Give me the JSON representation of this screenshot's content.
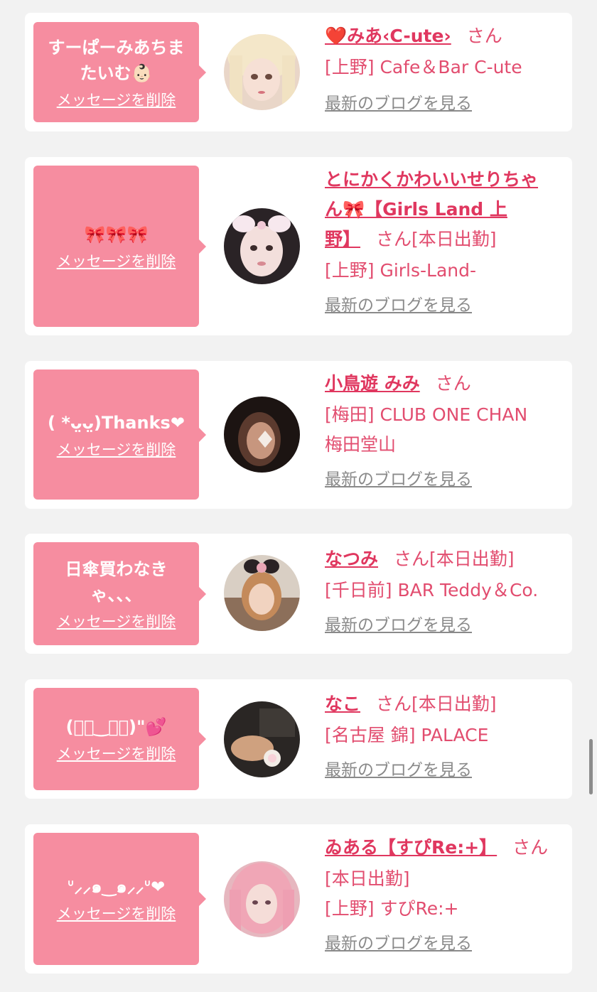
{
  "delete_label": "メッセージを削除",
  "blog_label": "最新のブログを見る",
  "honorific": "さん",
  "colors": {
    "background": "#f2f2f2",
    "bubble": "#f68da0",
    "accent_text": "#e24d6f",
    "link_gray": "#8a8a8a"
  },
  "messages": [
    {
      "bubble_text_1": "すーぱーみあちま",
      "bubble_text_2": "たいむ👶🏻",
      "name": "❤️みあ‹C-ute›",
      "status": "",
      "shop": "[上野] Cafe＆Bar C-ute",
      "shop_2": ""
    },
    {
      "bubble_text_1": "🎀🎀🎀",
      "bubble_text_2": "",
      "name_line_1": "とにかくかわいいせりちゃ",
      "name_line_2": "ん🎀【Girls Land 上",
      "name_line_3": "野】",
      "status": "[本日出勤]",
      "shop": "[上野] Girls-Land-"
    },
    {
      "bubble_text_1": "( *ᴗ̤ᴗ̤)Thanks❤",
      "bubble_text_2": "",
      "name": "小鳥遊 みみ",
      "status": "",
      "shop": "[梅田] CLUB ONE CHAN",
      "shop_2": "梅田堂山"
    },
    {
      "bubble_text_1": "日傘買わなき",
      "bubble_text_2": "ゃ、、、",
      "name": "なつみ",
      "status": "[本日出勤]",
      "shop": "[千日前] BAR Teddy＆Co."
    },
    {
      "bubble_text_1": "(ﾞ・‿・ﾞ)\"💕",
      "bubble_text_2": "",
      "name": "なこ",
      "status": "[本日出勤]",
      "shop": "[名古屋 錦] PALACE"
    },
    {
      "bubble_text_1": "ᐡ⸝⸝๑‿๑⸝⸝ᐡ❤",
      "bubble_text_2": "",
      "name": "ゐある【すぴRe:+】",
      "status": "[本日出勤]",
      "shop": "[上野] すぴRe:+"
    }
  ]
}
